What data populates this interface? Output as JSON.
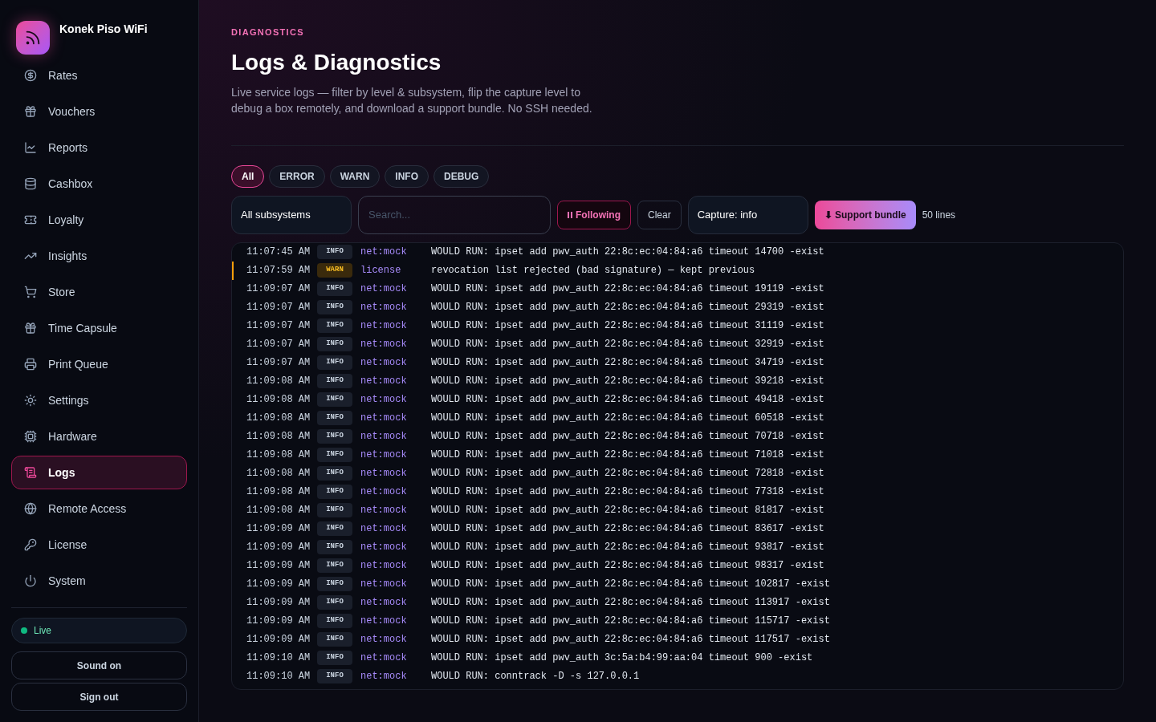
{
  "brand": {
    "name": "Konek Piso WiFi"
  },
  "nav": [
    {
      "label": "Rates",
      "selected": false
    },
    {
      "label": "Vouchers",
      "selected": false
    },
    {
      "label": "Reports",
      "selected": false
    },
    {
      "label": "Cashbox",
      "selected": false
    },
    {
      "label": "Loyalty",
      "selected": false
    },
    {
      "label": "Insights",
      "selected": false
    },
    {
      "label": "Store",
      "selected": false
    },
    {
      "label": "Time Capsule",
      "selected": false
    },
    {
      "label": "Print Queue",
      "selected": false
    },
    {
      "label": "Settings",
      "selected": false
    },
    {
      "label": "Hardware",
      "selected": false
    },
    {
      "label": "Logs",
      "selected": true
    },
    {
      "label": "Remote Access",
      "selected": false
    },
    {
      "label": "License",
      "selected": false
    },
    {
      "label": "System",
      "selected": false
    }
  ],
  "status": {
    "label": "Live",
    "color": "#10b981"
  },
  "sidebar_buttons": [
    "Sound on",
    "Sign out"
  ],
  "header": {
    "eyebrow": "DIAGNOSTICS",
    "title": "Logs & Diagnostics",
    "description": "Live service logs — filter by level & subsystem, flip the capture level to debug a box remotely, and download a support bundle. No SSH needed."
  },
  "level_filters": [
    {
      "label": "All",
      "selected": true
    },
    {
      "label": "ERROR",
      "selected": false
    },
    {
      "label": "WARN",
      "selected": false
    },
    {
      "label": "INFO",
      "selected": false
    },
    {
      "label": "DEBUG",
      "selected": false
    }
  ],
  "toolbar": {
    "subsystem": "All subsystems",
    "search_placeholder": "Search...",
    "follow": {
      "label": "Following",
      "on": true
    },
    "clear": "Clear",
    "capture": "Capture: info",
    "bundle": "⬇ Support bundle",
    "line_count": "50 lines"
  },
  "logs": [
    {
      "time": "11:07:45 AM",
      "level": "INFO",
      "kind": "info",
      "source": "net:mock",
      "message": "WOULD RUN: ipset add pwv_auth 22:8c:ec:04:84:a6 timeout 14700 -exist"
    },
    {
      "time": "11:07:59 AM",
      "level": "WARN",
      "kind": "warn",
      "source": "license",
      "message": "revocation list rejected (bad signature) — kept previous"
    },
    {
      "time": "11:09:07 AM",
      "level": "INFO",
      "kind": "info",
      "source": "net:mock",
      "message": "WOULD RUN: ipset add pwv_auth 22:8c:ec:04:84:a6 timeout 19119 -exist"
    },
    {
      "time": "11:09:07 AM",
      "level": "INFO",
      "kind": "info",
      "source": "net:mock",
      "message": "WOULD RUN: ipset add pwv_auth 22:8c:ec:04:84:a6 timeout 29319 -exist"
    },
    {
      "time": "11:09:07 AM",
      "level": "INFO",
      "kind": "info",
      "source": "net:mock",
      "message": "WOULD RUN: ipset add pwv_auth 22:8c:ec:04:84:a6 timeout 31119 -exist"
    },
    {
      "time": "11:09:07 AM",
      "level": "INFO",
      "kind": "info",
      "source": "net:mock",
      "message": "WOULD RUN: ipset add pwv_auth 22:8c:ec:04:84:a6 timeout 32919 -exist"
    },
    {
      "time": "11:09:07 AM",
      "level": "INFO",
      "kind": "info",
      "source": "net:mock",
      "message": "WOULD RUN: ipset add pwv_auth 22:8c:ec:04:84:a6 timeout 34719 -exist"
    },
    {
      "time": "11:09:08 AM",
      "level": "INFO",
      "kind": "info",
      "source": "net:mock",
      "message": "WOULD RUN: ipset add pwv_auth 22:8c:ec:04:84:a6 timeout 39218 -exist"
    },
    {
      "time": "11:09:08 AM",
      "level": "INFO",
      "kind": "info",
      "source": "net:mock",
      "message": "WOULD RUN: ipset add pwv_auth 22:8c:ec:04:84:a6 timeout 49418 -exist"
    },
    {
      "time": "11:09:08 AM",
      "level": "INFO",
      "kind": "info",
      "source": "net:mock",
      "message": "WOULD RUN: ipset add pwv_auth 22:8c:ec:04:84:a6 timeout 60518 -exist"
    },
    {
      "time": "11:09:08 AM",
      "level": "INFO",
      "kind": "info",
      "source": "net:mock",
      "message": "WOULD RUN: ipset add pwv_auth 22:8c:ec:04:84:a6 timeout 70718 -exist"
    },
    {
      "time": "11:09:08 AM",
      "level": "INFO",
      "kind": "info",
      "source": "net:mock",
      "message": "WOULD RUN: ipset add pwv_auth 22:8c:ec:04:84:a6 timeout 71018 -exist"
    },
    {
      "time": "11:09:08 AM",
      "level": "INFO",
      "kind": "info",
      "source": "net:mock",
      "message": "WOULD RUN: ipset add pwv_auth 22:8c:ec:04:84:a6 timeout 72818 -exist"
    },
    {
      "time": "11:09:08 AM",
      "level": "INFO",
      "kind": "info",
      "source": "net:mock",
      "message": "WOULD RUN: ipset add pwv_auth 22:8c:ec:04:84:a6 timeout 77318 -exist"
    },
    {
      "time": "11:09:08 AM",
      "level": "INFO",
      "kind": "info",
      "source": "net:mock",
      "message": "WOULD RUN: ipset add pwv_auth 22:8c:ec:04:84:a6 timeout 81817 -exist"
    },
    {
      "time": "11:09:09 AM",
      "level": "INFO",
      "kind": "info",
      "source": "net:mock",
      "message": "WOULD RUN: ipset add pwv_auth 22:8c:ec:04:84:a6 timeout 83617 -exist"
    },
    {
      "time": "11:09:09 AM",
      "level": "INFO",
      "kind": "info",
      "source": "net:mock",
      "message": "WOULD RUN: ipset add pwv_auth 22:8c:ec:04:84:a6 timeout 93817 -exist"
    },
    {
      "time": "11:09:09 AM",
      "level": "INFO",
      "kind": "info",
      "source": "net:mock",
      "message": "WOULD RUN: ipset add pwv_auth 22:8c:ec:04:84:a6 timeout 98317 -exist"
    },
    {
      "time": "11:09:09 AM",
      "level": "INFO",
      "kind": "info",
      "source": "net:mock",
      "message": "WOULD RUN: ipset add pwv_auth 22:8c:ec:04:84:a6 timeout 102817 -exist"
    },
    {
      "time": "11:09:09 AM",
      "level": "INFO",
      "kind": "info",
      "source": "net:mock",
      "message": "WOULD RUN: ipset add pwv_auth 22:8c:ec:04:84:a6 timeout 113917 -exist"
    },
    {
      "time": "11:09:09 AM",
      "level": "INFO",
      "kind": "info",
      "source": "net:mock",
      "message": "WOULD RUN: ipset add pwv_auth 22:8c:ec:04:84:a6 timeout 115717 -exist"
    },
    {
      "time": "11:09:09 AM",
      "level": "INFO",
      "kind": "info",
      "source": "net:mock",
      "message": "WOULD RUN: ipset add pwv_auth 22:8c:ec:04:84:a6 timeout 117517 -exist"
    },
    {
      "time": "11:09:10 AM",
      "level": "INFO",
      "kind": "info",
      "source": "net:mock",
      "message": "WOULD RUN: ipset add pwv_auth 3c:5a:b4:99:aa:04 timeout 900 -exist"
    },
    {
      "time": "11:09:10 AM",
      "level": "INFO",
      "kind": "info",
      "source": "net:mock",
      "message": "WOULD RUN: conntrack -D -s 127.0.0.1"
    }
  ]
}
